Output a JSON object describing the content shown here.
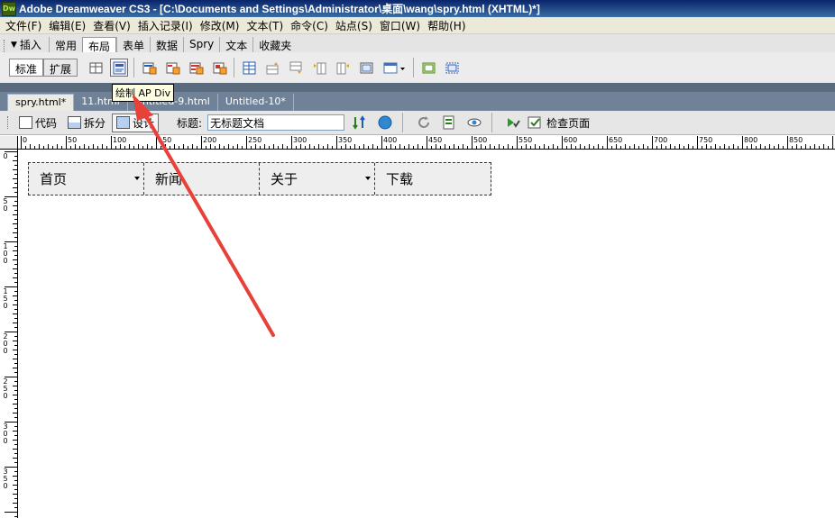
{
  "window": {
    "logo": "Dw",
    "title": "Adobe Dreamweaver CS3 - [C:\\Documents and Settings\\Administrator\\桌面\\wang\\spry.html (XHTML)*]"
  },
  "menu": [
    "文件(F)",
    "编辑(E)",
    "查看(V)",
    "插入记录(I)",
    "修改(M)",
    "文本(T)",
    "命令(C)",
    "站点(S)",
    "窗口(W)",
    "帮助(H)"
  ],
  "insert_bar": {
    "label": "插入",
    "tabs": [
      "常用",
      "布局",
      "表单",
      "数据",
      "Spry",
      "文本",
      "收藏夹"
    ],
    "active_tab": "布局",
    "mode_standard": "标准",
    "mode_extended": "扩展"
  },
  "tooltip": "绘制 AP Div",
  "doc_tabs": [
    "spry.html*",
    "11.html",
    "Untitled-9.html",
    "Untitled-10*"
  ],
  "doc_toolbar": {
    "code": "代码",
    "split": "拆分",
    "design": "设计",
    "title_label": "标题:",
    "title_value": "无标题文档",
    "check_page": "检查页面"
  },
  "ruler": {
    "h_labels": [
      "0",
      "50",
      "100",
      "150",
      "200",
      "250",
      "300",
      "350",
      "400",
      "450",
      "500",
      "550",
      "600",
      "650",
      "700",
      "750",
      "800",
      "850"
    ],
    "v_labels": [
      "0",
      "50",
      "100",
      "150",
      "200",
      "250",
      "300",
      "350"
    ]
  },
  "spry_menu": {
    "items": [
      {
        "label": "首页",
        "has_submenu": true
      },
      {
        "label": "新闻",
        "has_submenu": false
      },
      {
        "label": "关于",
        "has_submenu": true
      },
      {
        "label": "下载",
        "has_submenu": false
      }
    ]
  },
  "colors": {
    "annotation_arrow": "#e8413a",
    "title_bar": "#0a246a"
  }
}
